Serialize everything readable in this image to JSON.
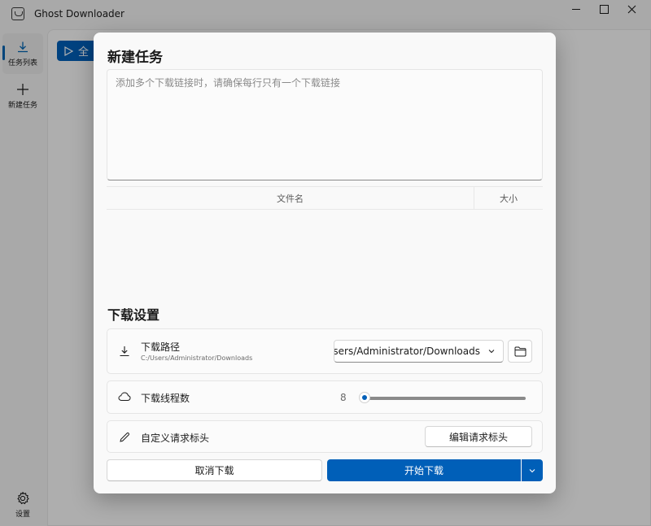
{
  "window": {
    "title": "Ghost Downloader",
    "icons": {
      "app": "ghost-app-icon",
      "minimize": "minimize-icon",
      "maximize": "maximize-icon",
      "close": "close-icon"
    }
  },
  "sidebar": {
    "items": [
      {
        "label": "任务列表",
        "icon": "download-icon",
        "active": true
      },
      {
        "label": "新建任务",
        "icon": "plus-icon",
        "active": false
      }
    ],
    "settings": {
      "label": "设置",
      "icon": "gear-icon"
    }
  },
  "background": {
    "partial_button_label": "全"
  },
  "dialog": {
    "title": "新建任务",
    "links_placeholder": "添加多个下载链接时，请确保每行只有一个下载链接",
    "table": {
      "columns": [
        "文件名",
        "大小"
      ],
      "rows": []
    },
    "settings_title": "下载设置",
    "download_path": {
      "title": "下载路径",
      "value": "C:/Users/Administrator/Downloads",
      "combo_text": "C:/Users/Administrator/Downloads",
      "icon": "download-icon",
      "browse_icon": "folder-icon"
    },
    "threads": {
      "title": "下载线程数",
      "value": "8",
      "icon": "cloud-icon",
      "level": 0.03
    },
    "headers": {
      "title": "自定义请求标头",
      "button_label": "编辑请求标头",
      "icon": "pencil-icon"
    },
    "buttons": {
      "cancel": "取消下载",
      "start": "开始下载"
    }
  },
  "colors": {
    "accent": "#005fb8",
    "overlay": "rgba(0,0,0,0.30)"
  }
}
